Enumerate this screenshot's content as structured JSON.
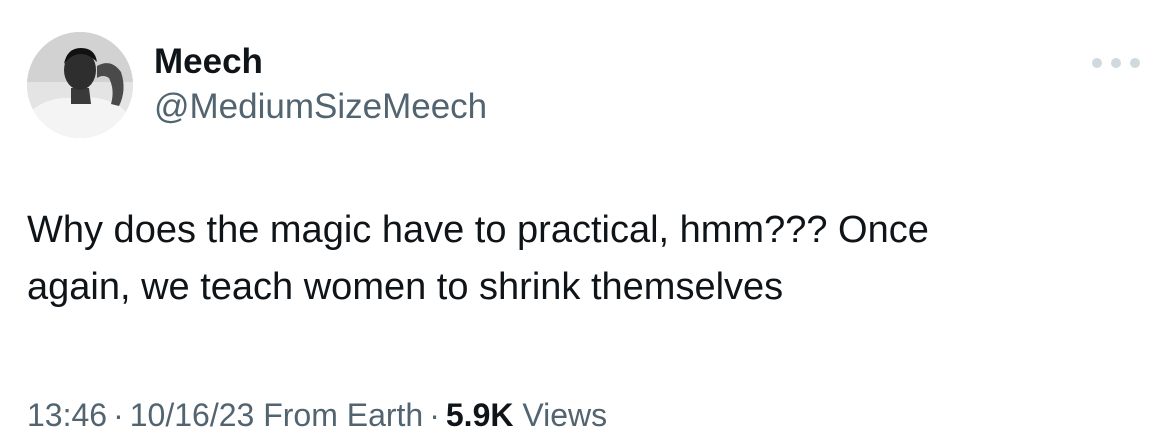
{
  "author": {
    "name": "Meech",
    "handle": "@MediumSizeMeech",
    "avatar_icon": "profile-photo"
  },
  "more_button": {
    "icon": "more-horizontal-icon",
    "color": "#cfd9de"
  },
  "tweet": {
    "text": "Why does the magic have to practical, hmm??? Once\nagain, we teach women to shrink themselves"
  },
  "meta": {
    "time": "13:46",
    "separator": "·",
    "date": "10/16/23",
    "source": "From Earth",
    "views_count": "5.9K",
    "views_label": "Views"
  },
  "colors": {
    "primary_text": "#0f1419",
    "secondary_text": "#536471",
    "background": "#ffffff"
  }
}
